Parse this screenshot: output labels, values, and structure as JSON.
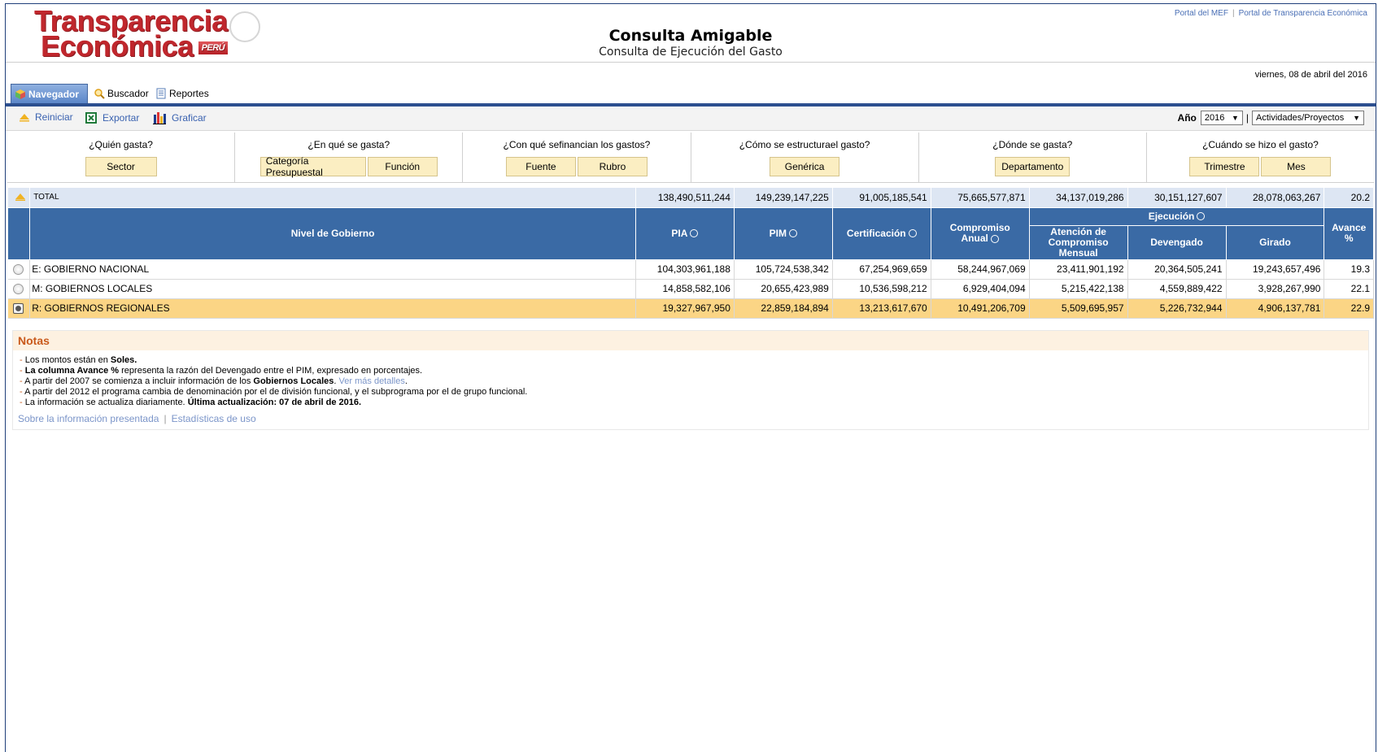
{
  "brand": {
    "line1": "Transparencia",
    "line2": "Económica",
    "badge": "PERÚ"
  },
  "header": {
    "title": "Consulta Amigable",
    "subtitle": "Consulta de Ejecución del Gasto",
    "links": [
      "Portal del MEF",
      "Portal de Transparencia Económica"
    ],
    "link_sep": "|"
  },
  "date": "viernes, 08 de abril del 2016",
  "tabs": [
    {
      "label": "Navegador",
      "icon": "cube-icon",
      "active": true
    },
    {
      "label": "Buscador",
      "icon": "magnifier-icon",
      "active": false
    },
    {
      "label": "Reportes",
      "icon": "document-icon",
      "active": false
    }
  ],
  "toolbar": {
    "reiniciar": "Reiniciar",
    "exportar": "Exportar",
    "graficar": "Graficar",
    "year_label": "Año",
    "year_value": "2016",
    "sep": "|",
    "mode_value": "Actividades/Proyectos"
  },
  "questions": [
    {
      "title": "¿Quién gasta?",
      "buttons": [
        "Sector"
      ]
    },
    {
      "title": "¿En qué se gasta?",
      "buttons": [
        "Categoría Presupuestal",
        "Función"
      ]
    },
    {
      "title": "¿Con qué se financian los gastos?",
      "title_l1": "¿Con qué se",
      "title_l2": "financian los gastos?",
      "buttons": [
        "Fuente",
        "Rubro"
      ]
    },
    {
      "title": "¿Cómo se estructura el gasto?",
      "title_l1": "¿Cómo se estructura",
      "title_l2": "el gasto?",
      "buttons": [
        "Genérica"
      ]
    },
    {
      "title": "¿Dónde se gasta?",
      "buttons": [
        "Departamento"
      ]
    },
    {
      "title": "¿Cuándo se hizo el gasto?",
      "buttons": [
        "Trimestre",
        "Mes"
      ]
    }
  ],
  "table": {
    "total": {
      "label": "TOTAL",
      "values": [
        "138,490,511,244",
        "149,239,147,225",
        "91,005,185,541",
        "75,665,577,871",
        "34,137,019,286",
        "30,151,127,607",
        "28,078,063,267",
        "20.2"
      ]
    },
    "headers": {
      "nivel": "Nivel de Gobierno",
      "pia": "PIA",
      "pim": "PIM",
      "certificacion": "Certificación",
      "compromiso_l1": "Compromiso",
      "compromiso_l2": "Anual",
      "ejecucion": "Ejecución",
      "atencion_l1": "Atención de",
      "atencion_l2": "Compromiso",
      "atencion_l3": "Mensual",
      "devengado": "Devengado",
      "girado": "Girado",
      "avance_l1": "Avance",
      "avance_l2": "%"
    },
    "rows": [
      {
        "name": "E: GOBIERNO NACIONAL",
        "values": [
          "104,303,961,188",
          "105,724,538,342",
          "67,254,969,659",
          "58,244,967,069",
          "23,411,901,192",
          "20,364,505,241",
          "19,243,657,496",
          "19.3"
        ],
        "selected": false
      },
      {
        "name": "M: GOBIERNOS LOCALES",
        "values": [
          "14,858,582,106",
          "20,655,423,989",
          "10,536,598,212",
          "6,929,404,094",
          "5,215,422,138",
          "4,559,889,422",
          "3,928,267,990",
          "22.1"
        ],
        "selected": false
      },
      {
        "name": "R: GOBIERNOS REGIONALES",
        "values": [
          "19,327,967,950",
          "22,859,184,894",
          "13,213,617,670",
          "10,491,206,709",
          "5,509,695,957",
          "5,226,732,944",
          "4,906,137,781",
          "22.9"
        ],
        "selected": true
      }
    ]
  },
  "notes": {
    "title": "Notas",
    "n1_pre": "Los montos están en ",
    "n1_bold": "Soles.",
    "n2_bold": "La columna Avance %",
    "n2_rest": " representa la razón del Devengado entre el PIM, expresado en porcentajes.",
    "n3_pre": "A partir del 2007 se comienza a incluir información de los ",
    "n3_bold": "Gobiernos Locales",
    "n3_dot": ". ",
    "n3_link": "Ver más detalles",
    "n3_end": ".",
    "n4": "A partir del 2012 el programa cambia de denominación por el de división funcional, y el subprograma por el de grupo funcional.",
    "n5_pre": "La información se actualiza diariamente. ",
    "n5_bold": "Última actualización: 07 de abril de 2016."
  },
  "footer": {
    "link1": "Sobre la información presentada",
    "sep": "|",
    "link2": "Estadísticas de uso"
  },
  "colors": {
    "brand_red": "#c0272d",
    "header_blue": "#3a6aa5",
    "selected_row": "#fbd585",
    "button_bg": "#fbeec2",
    "notes_orange": "#c9591b"
  }
}
